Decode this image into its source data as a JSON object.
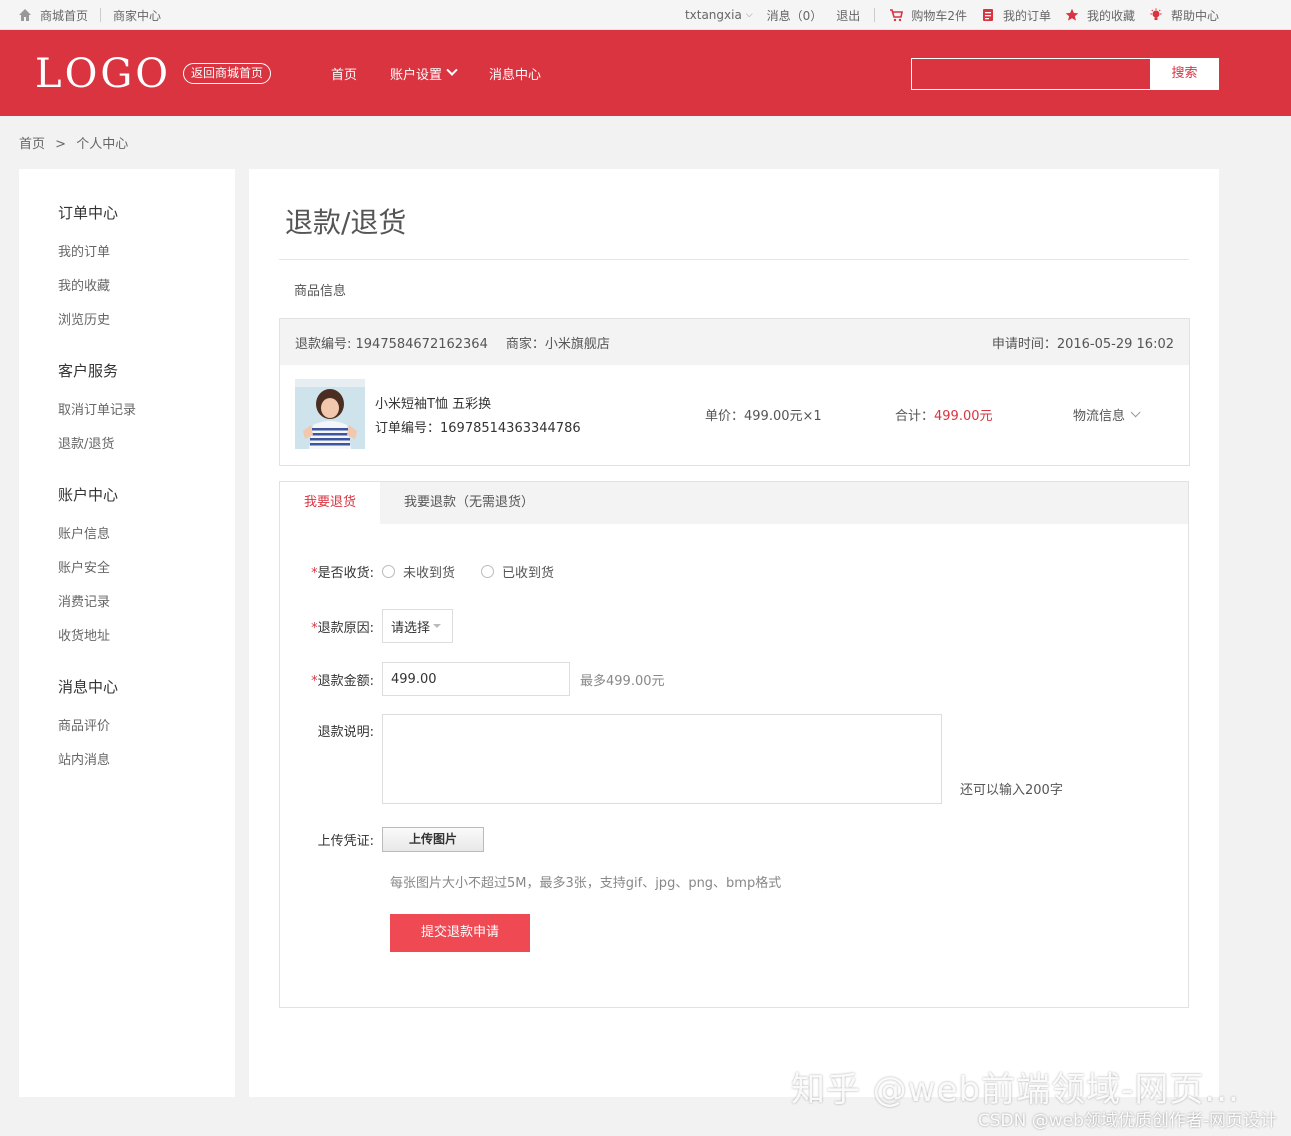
{
  "topbar": {
    "home": "商城首页",
    "merchant": "商家中心",
    "username": "txtangxia",
    "messages": "消息（0）",
    "logout": "退出",
    "cart": "购物车2件",
    "my_orders": "我的订单",
    "favorites": "我的收藏",
    "help": "帮助中心"
  },
  "header": {
    "logo": "LOGO",
    "back_home": "返回商城首页",
    "nav": [
      "首页",
      "账户设置",
      "消息中心"
    ],
    "search_button": "搜索",
    "brand_color": "#d93440"
  },
  "breadcrumb": [
    "首页",
    ">",
    "个人中心"
  ],
  "sidebar": {
    "groups": [
      {
        "title": "订单中心",
        "links": [
          "我的订单",
          "我的收藏",
          "浏览历史"
        ]
      },
      {
        "title": "客户服务",
        "links": [
          "取消订单记录",
          "退款/退货"
        ]
      },
      {
        "title": "账户中心",
        "links": [
          "账户信息",
          "账户安全",
          "消费记录",
          "收货地址"
        ]
      },
      {
        "title": "消息中心",
        "links": [
          "商品评价",
          "站内消息"
        ]
      }
    ]
  },
  "main": {
    "title": "退款/退货",
    "section_label": "商品信息",
    "goods": {
      "refund_no": "退款编号: 1947584672162364",
      "merchant": "商家：小米旗舰店",
      "apply_time": "申请时间：2016-05-29 16:02",
      "name": "小米短袖T恤 五彩换",
      "order_no": "订单编号：16978514363344786",
      "unit_price": "单价：499.00元×1",
      "total_label": "合计：",
      "total_value": "499.00元",
      "logistics": "物流信息"
    },
    "tabs": [
      "我要退货",
      "我要退款（无需退货）"
    ],
    "form": {
      "received_label": "是否收货:",
      "radio_options": [
        "未收到货",
        "已收到货"
      ],
      "reason_label": "退款原因:",
      "reason_value": "请选择",
      "amount_label": "退款金额:",
      "amount_value": "499.00",
      "amount_hint": "最多499.00元",
      "desc_label": "退款说明:",
      "desc_counter": "还可以输入200字",
      "upload_label": "上传凭证:",
      "upload_button": "上传图片",
      "upload_note": "每张图片大小不超过5M，最多3张，支持gif、jpg、png、bmp格式",
      "submit": "提交退款申请"
    }
  },
  "watermark": {
    "line1": "知乎 @web前端领域-网页...",
    "line2": "CSDN @web领域优质创作者-网页设计"
  }
}
